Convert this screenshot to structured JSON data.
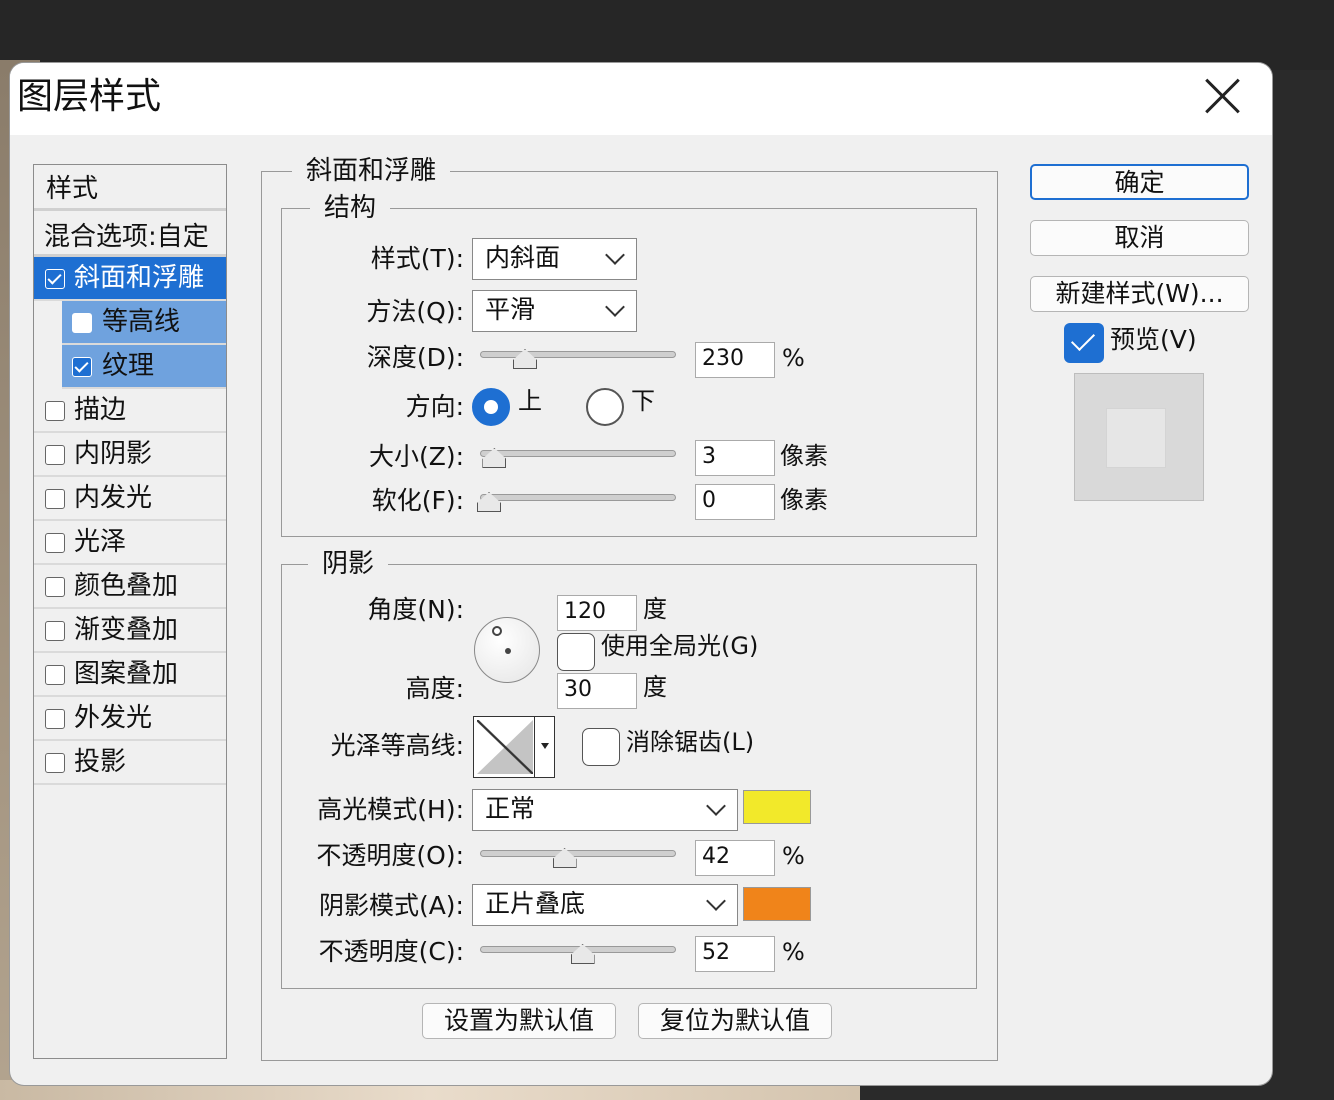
{
  "dialog": {
    "title": "图层样式"
  },
  "styles_list": {
    "header": "样式",
    "blend_options": "混合选项:自定",
    "items": [
      {
        "label": "斜面和浮雕",
        "checked": true,
        "active": true
      },
      {
        "label": "等高线",
        "checked": false,
        "sub": true
      },
      {
        "label": "纹理",
        "checked": true,
        "sub": true
      },
      {
        "label": "描边",
        "checked": false
      },
      {
        "label": "内阴影",
        "checked": false
      },
      {
        "label": "内发光",
        "checked": false
      },
      {
        "label": "光泽",
        "checked": false
      },
      {
        "label": "颜色叠加",
        "checked": false
      },
      {
        "label": "渐变叠加",
        "checked": false
      },
      {
        "label": "图案叠加",
        "checked": false
      },
      {
        "label": "外发光",
        "checked": false
      },
      {
        "label": "投影",
        "checked": false
      }
    ]
  },
  "bevel": {
    "section_title": "斜面和浮雕",
    "structure": {
      "title": "结构",
      "style_label": "样式(T):",
      "style_value": "内斜面",
      "technique_label": "方法(Q):",
      "technique_value": "平滑",
      "depth_label": "深度(D):",
      "depth_value": "230",
      "depth_unit": "%",
      "depth_slider": 0.2,
      "direction_label": "方向:",
      "direction_up": "上",
      "direction_down": "下",
      "size_label": "大小(Z):",
      "size_value": "3",
      "size_unit": "像素",
      "size_slider": 0.03,
      "soften_label": "软化(F):",
      "soften_value": "0",
      "soften_unit": "像素",
      "soften_slider": 0.0
    },
    "shading": {
      "title": "阴影",
      "angle_label": "角度(N):",
      "angle_value": "120",
      "angle_unit": "度",
      "global_light_label": "使用全局光(G)",
      "altitude_label": "高度:",
      "altitude_value": "30",
      "altitude_unit": "度",
      "gloss_label": "光泽等高线:",
      "anti_alias_label": "消除锯齿(L)",
      "highlight_label": "高光模式(H):",
      "highlight_mode": "正常",
      "highlight_color": "#f2e92a",
      "highlight_opacity_label": "不透明度(O):",
      "highlight_opacity": "42",
      "highlight_opacity_unit": "%",
      "highlight_slider": 0.42,
      "shadow_label": "阴影模式(A):",
      "shadow_mode": "正片叠底",
      "shadow_color": "#f0841a",
      "shadow_opacity_label": "不透明度(C):",
      "shadow_opacity": "52",
      "shadow_opacity_unit": "%",
      "shadow_slider": 0.52
    },
    "make_default": "设置为默认值",
    "reset_default": "复位为默认值"
  },
  "buttons": {
    "ok": "确定",
    "cancel": "取消",
    "new_style": "新建样式(W)...",
    "preview_label": "预览(V)"
  }
}
